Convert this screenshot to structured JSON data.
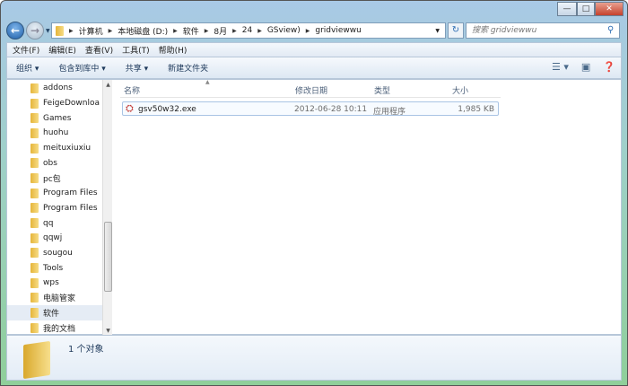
{
  "window": {
    "minimize": "—",
    "maximize": "□",
    "close": "✕"
  },
  "address": {
    "crumbs": [
      "计算机",
      "本地磁盘 (D:)",
      "软件",
      "8月",
      "24",
      "GSview)",
      "gridviewwu"
    ],
    "search_placeholder": "搜索 gridviewwu"
  },
  "menu": [
    "文件(F)",
    "编辑(E)",
    "查看(V)",
    "工具(T)",
    "帮助(H)"
  ],
  "toolbar": {
    "organize": "组织 ▾",
    "include": "包含到库中 ▾",
    "share": "共享 ▾",
    "new_folder": "新建文件夹"
  },
  "sidebar": [
    "addons",
    "FeigeDownloa",
    "Games",
    "huohu",
    "meituxiuxiu",
    "obs",
    "pc包",
    "Program Files",
    "Program Files",
    "qq",
    "qqwj",
    "sougou",
    "Tools",
    "wps",
    "电脑管家",
    "软件",
    "我的文档"
  ],
  "columns": {
    "name": "名称",
    "date": "修改日期",
    "type": "类型",
    "size": "大小"
  },
  "files": [
    {
      "name": "gsv50w32.exe",
      "date": "2012-06-28 10:11",
      "type": "应用程序",
      "size": "1,985 KB"
    }
  ],
  "status": {
    "count": "1 个对象"
  }
}
